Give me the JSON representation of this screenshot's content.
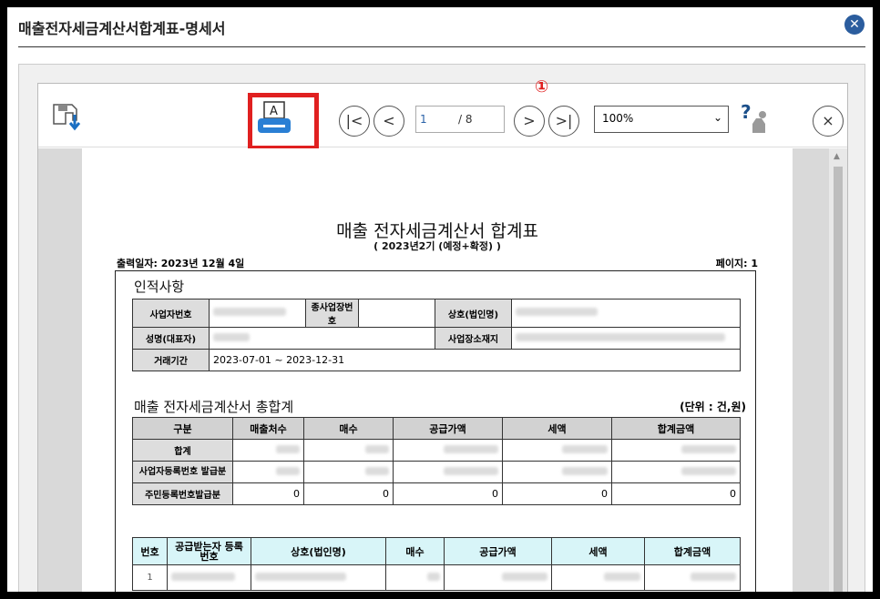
{
  "window": {
    "title": "매출전자세금계산서합계표-명세서",
    "close_icon": "close-icon"
  },
  "toolbar": {
    "save_icon": "save-download-icon",
    "print_icon": "print-icon",
    "first_icon": "first-page-icon",
    "prev_icon": "prev-page-icon",
    "next_icon": "next-page-icon",
    "last_icon": "last-page-icon",
    "first_label": "|<",
    "prev_label": "<",
    "next_label": ">",
    "last_label": ">|",
    "current_page": "1",
    "total_pages": "/ 8",
    "zoom": "100%",
    "help_icon": "help-icon",
    "close_label": "×",
    "annotation": "①"
  },
  "doc": {
    "title": "매출 전자세금계산서 합계표",
    "subtitle": "( 2023년2기 (예정+확정) )",
    "print_date": "출력일자:   2023년 12월 4일",
    "page_label": "페이지:      1",
    "section1": "인적사항",
    "info": {
      "biz_no": "사업자번호",
      "sub_biz": "종사업장번호",
      "company": "상호(법인명)",
      "name": "성명(대표자)",
      "address": "사업장소재지",
      "period_label": "거래기간",
      "period": "2023-07-01 ~ 2023-12-31"
    },
    "section2": "매출 전자세금계산서 총합계",
    "unit": "(단위 : 건,원)",
    "summary": {
      "headers": [
        "구분",
        "매출처수",
        "매수",
        "공급가액",
        "세액",
        "합계금액"
      ],
      "rows": [
        {
          "label": "합계"
        },
        {
          "label": "사업자등록번호 발급분"
        },
        {
          "label": "주민등록번호발급분",
          "values": [
            "0",
            "0",
            "0",
            "0",
            "0"
          ]
        }
      ]
    },
    "detail": {
      "headers": [
        "번호",
        "공급받는자 등록번호",
        "상호(법인명)",
        "매수",
        "공급가액",
        "세액",
        "합계금액"
      ],
      "row1_no": "1"
    }
  }
}
